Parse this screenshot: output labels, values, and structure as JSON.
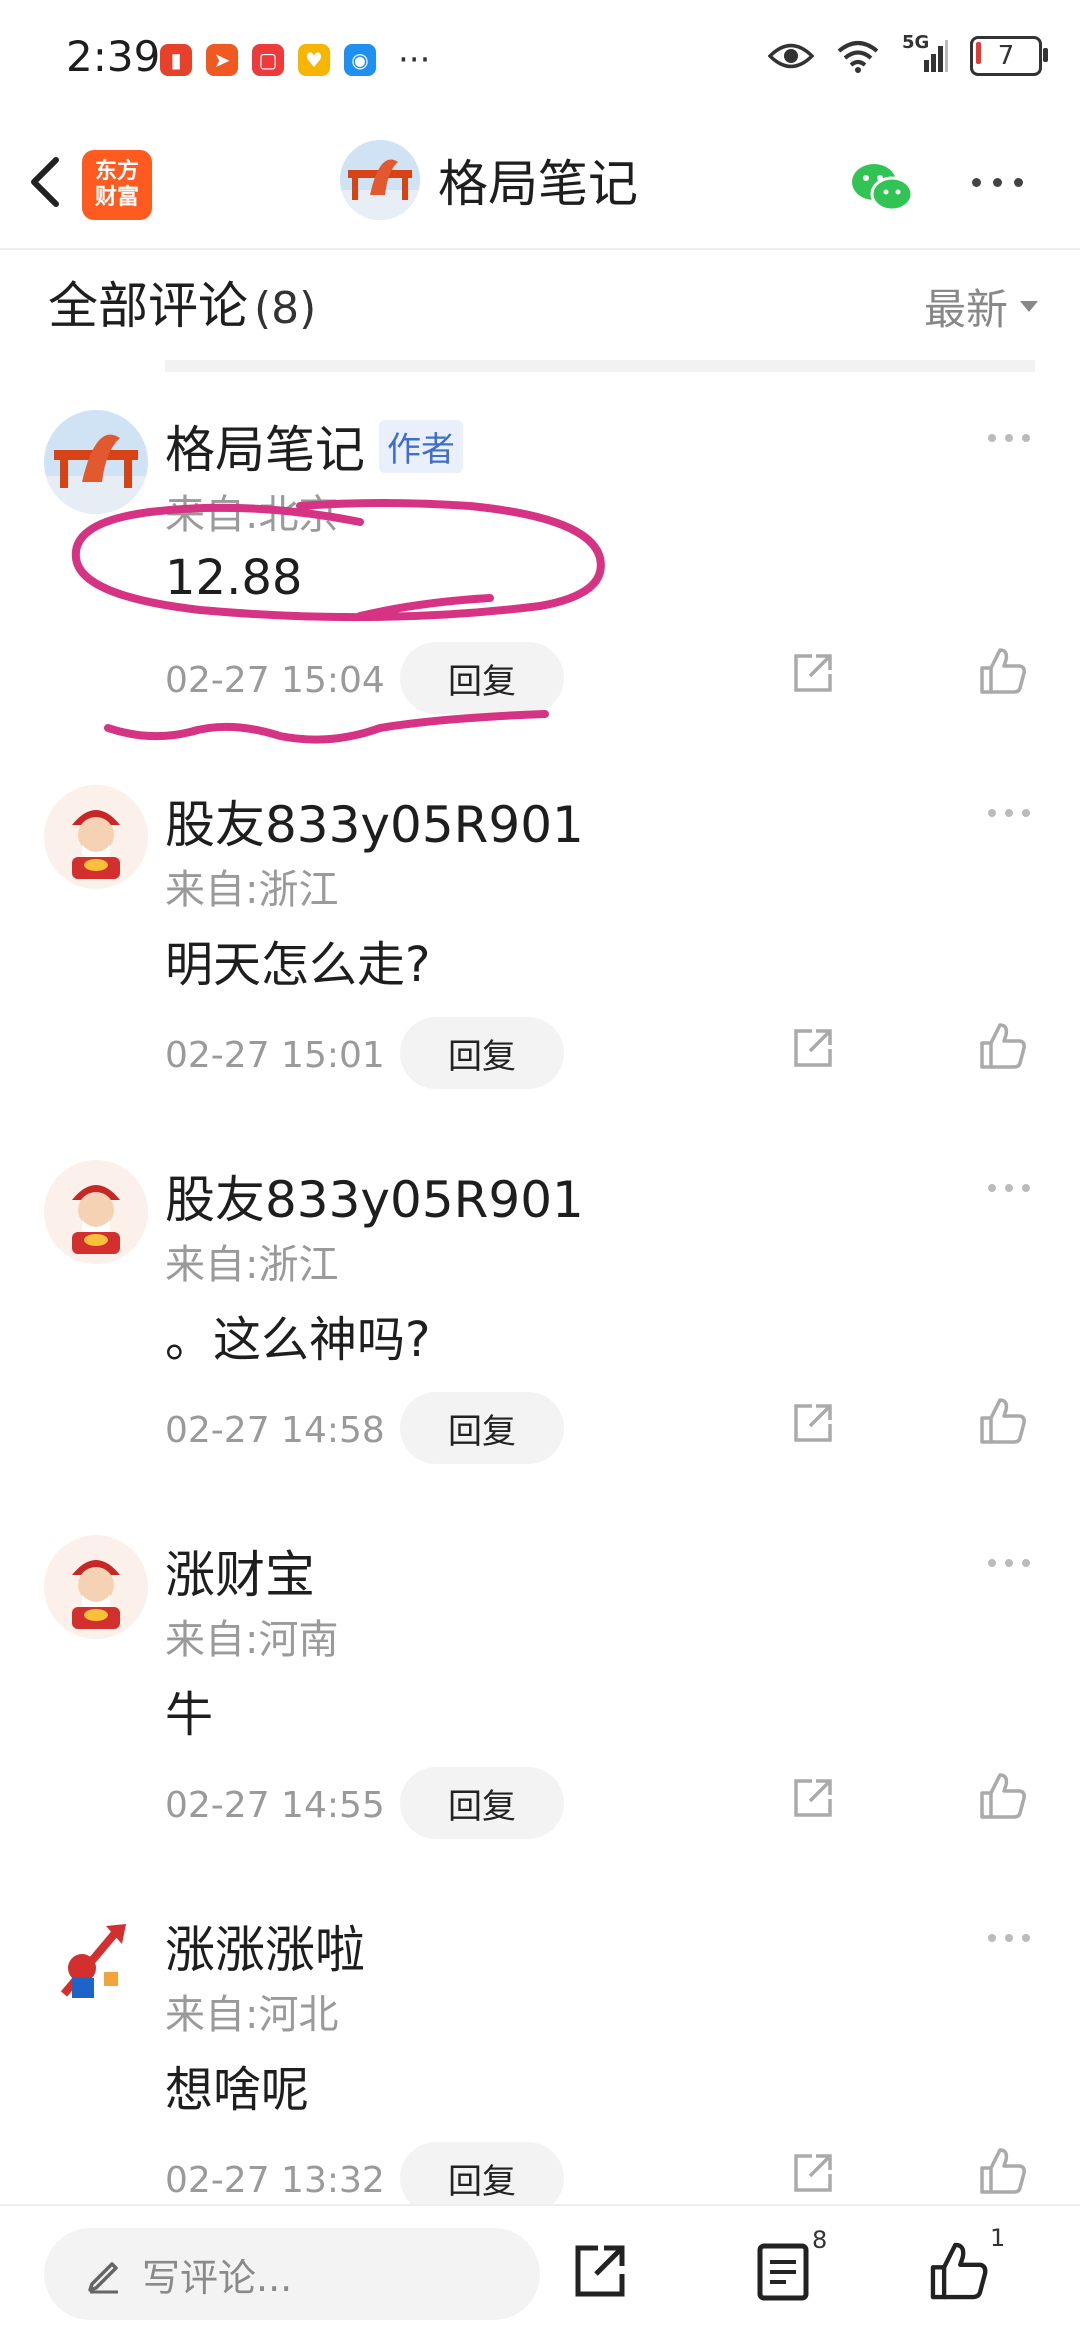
{
  "status_bar": {
    "time": "2:39",
    "network": "5G",
    "battery": "7"
  },
  "nav": {
    "brand_line1": "东方",
    "brand_line2": "财富",
    "title": "格局笔记"
  },
  "comments_header": {
    "title": "全部评论",
    "count": "(8)",
    "sort_label": "最新"
  },
  "comments": [
    {
      "name": "格局笔记",
      "badge": "作者",
      "location": "来自:北京",
      "text": "12.88",
      "time": "02-27 15:04",
      "reply": "回复"
    },
    {
      "name": "股友833y05R901",
      "location": "来自:浙江",
      "text": "明天怎么走?",
      "time": "02-27 15:01",
      "reply": "回复"
    },
    {
      "name": "股友833y05R901",
      "location": "来自:浙江",
      "text": "。这么神吗?",
      "time": "02-27 14:58",
      "reply": "回复"
    },
    {
      "name": "涨财宝",
      "location": "来自:河南",
      "text": "牛",
      "time": "02-27 14:55",
      "reply": "回复"
    },
    {
      "name": "涨涨涨啦",
      "location": "来自:河北",
      "text": "想啥呢",
      "time": "02-27 13:32",
      "reply": "回复"
    }
  ],
  "bottom_bar": {
    "input_placeholder": "写评论...",
    "comment_count": "8",
    "like_count": "1"
  },
  "colors": {
    "brand": "#ff5a1f",
    "author_badge": "#3f6fc8",
    "annotation": "#d63384",
    "wechat": "#31c454"
  }
}
